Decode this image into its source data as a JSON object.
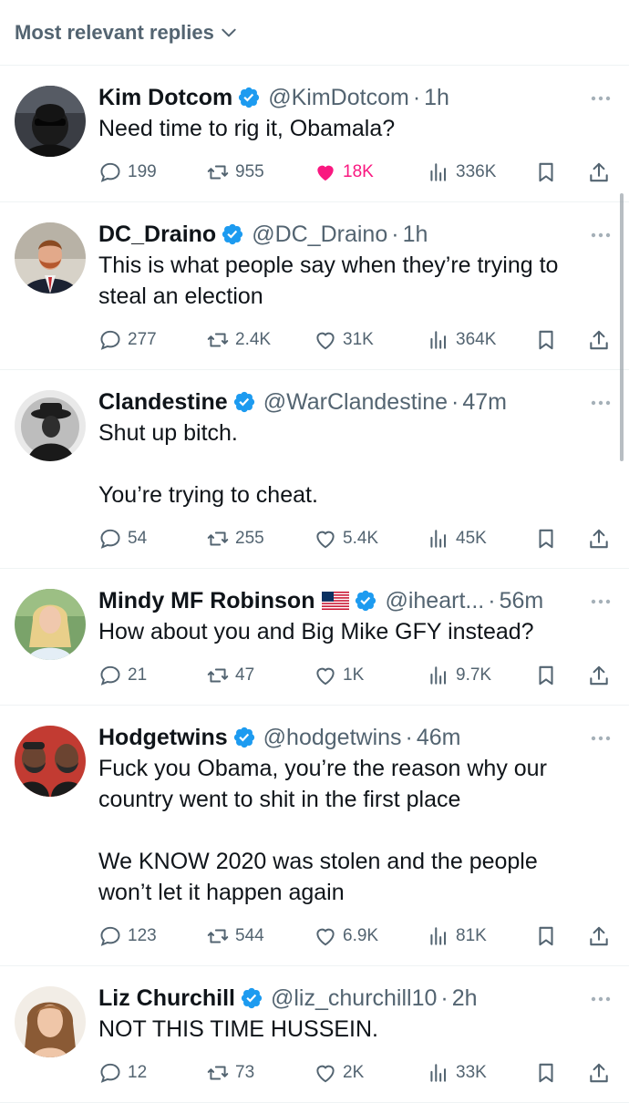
{
  "sort": {
    "label": "Most relevant replies"
  },
  "colors": {
    "verified": "#1d9bf0",
    "like_active": "#f91880",
    "secondary": "#536471"
  },
  "replies": [
    {
      "name": "Kim Dotcom",
      "handle": "@KimDotcom",
      "time": "1h",
      "text": "Need time to rig it, Obamala?",
      "replies": "199",
      "reposts": "955",
      "likes": "18K",
      "views": "336K",
      "liked": true,
      "avatar": "kimdotcom-avatar",
      "height": 150
    },
    {
      "name": "DC_Draino",
      "handle": "@DC_Draino",
      "time": "1h",
      "text": "This is what people say when they’re trying to steal an election",
      "replies": "277",
      "reposts": "2.4K",
      "likes": "31K",
      "views": "364K",
      "liked": false,
      "avatar": "dcdraino-avatar",
      "height": 184
    },
    {
      "name": "Clandestine",
      "handle": "@WarClandestine",
      "time": "47m",
      "text": "Shut up bitch.\n\nYou’re trying to cheat.",
      "replies": "54",
      "reposts": "255",
      "likes": "5.4K",
      "views": "45K",
      "liked": false,
      "avatar": "clandestine-avatar",
      "height": 218
    },
    {
      "name": "Mindy MF Robinson",
      "handle": "@iheart...",
      "time": "56m",
      "text": "How about you and Big Mike GFY instead?",
      "replies": "21",
      "reposts": "47",
      "likes": "1K",
      "views": "9.7K",
      "liked": false,
      "avatar": "mindy-avatar",
      "flag": "us-flag-icon",
      "height": 150
    },
    {
      "name": "Hodgetwins",
      "handle": "@hodgetwins",
      "time": "46m",
      "text": "Fuck you Obama, you’re the reason why our country went to shit in the first place\n\nWe KNOW 2020 was stolen and the people won’t let it happen again",
      "replies": "123",
      "reposts": "544",
      "likes": "6.9K",
      "views": "81K",
      "liked": false,
      "avatar": "hodgetwins-avatar",
      "height": 286
    },
    {
      "name": "Liz Churchill",
      "handle": "@liz_churchill10",
      "time": "2h",
      "text": "NOT THIS TIME HUSSEIN.",
      "replies": "12",
      "reposts": "73",
      "likes": "2K",
      "views": "33K",
      "liked": false,
      "avatar": "lizchurchill-avatar",
      "height": 150
    }
  ]
}
